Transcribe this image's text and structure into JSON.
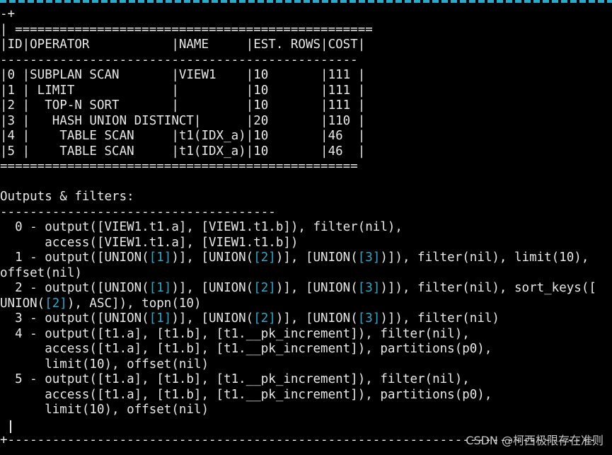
{
  "terminal": {
    "lines": [
      [
        {
          "t": "-+"
        }
      ],
      [
        {
          "t": "| ================================================"
        }
      ],
      [
        {
          "t": "|ID|OPERATOR           |NAME     |EST. ROWS|COST|"
        }
      ],
      [
        {
          "t": "------------------------------------------------"
        }
      ],
      [
        {
          "t": "|0 |SUBPLAN SCAN       |VIEW1    |10       |111 |"
        }
      ],
      [
        {
          "t": "|1 | LIMIT             |         |10       |111 |"
        }
      ],
      [
        {
          "t": "|2 |  TOP-N SORT       |         |10       |111 |"
        }
      ],
      [
        {
          "t": "|3 |   HASH UNION DISTINCT|      |20       |110 |"
        }
      ],
      [
        {
          "t": "|4 |    TABLE SCAN     |t1(IDX_a)|10       |46  |"
        }
      ],
      [
        {
          "t": "|5 |    TABLE SCAN     |t1(IDX_a)|10       |46  |"
        }
      ],
      [
        {
          "t": "================================================"
        }
      ],
      [
        {
          "t": ""
        }
      ],
      [
        {
          "t": "Outputs & filters:"
        }
      ],
      [
        {
          "t": "-------------------------------------"
        }
      ],
      [
        {
          "t": "  0 - output([VIEW1.t1.a], [VIEW1.t1.b]), filter(nil),"
        }
      ],
      [
        {
          "t": "      access([VIEW1.t1.a], [VIEW1.t1.b])"
        }
      ],
      [
        {
          "t": "  1 - output([UNION("
        },
        {
          "t": "[1]",
          "c": "ref"
        },
        {
          "t": ")], [UNION("
        },
        {
          "t": "[2]",
          "c": "ref"
        },
        {
          "t": ")], [UNION("
        },
        {
          "t": "[3]",
          "c": "ref"
        },
        {
          "t": ")]), filter(nil), limit(10),"
        }
      ],
      [
        {
          "t": "offset(nil)"
        }
      ],
      [
        {
          "t": "  2 - output([UNION("
        },
        {
          "t": "[1]",
          "c": "ref"
        },
        {
          "t": ")], [UNION("
        },
        {
          "t": "[2]",
          "c": "ref"
        },
        {
          "t": ")], [UNION("
        },
        {
          "t": "[3]",
          "c": "ref"
        },
        {
          "t": ")]), filter(nil), sort_keys(["
        }
      ],
      [
        {
          "t": "UNION("
        },
        {
          "t": "[2]",
          "c": "ref"
        },
        {
          "t": "), ASC]), topn(10)"
        }
      ],
      [
        {
          "t": "  3 - output([UNION("
        },
        {
          "t": "[1]",
          "c": "ref"
        },
        {
          "t": ")], [UNION("
        },
        {
          "t": "[2]",
          "c": "ref"
        },
        {
          "t": ")], [UNION("
        },
        {
          "t": "[3]",
          "c": "ref"
        },
        {
          "t": ")]), filter(nil)"
        }
      ],
      [
        {
          "t": "  4 - output([t1.a], [t1.b], [t1.__pk_increment]), filter(nil),"
        }
      ],
      [
        {
          "t": "      access([t1.a], [t1.b], [t1.__pk_increment]), partitions(p0),"
        }
      ],
      [
        {
          "t": "      limit(10), offset(nil)"
        }
      ],
      [
        {
          "t": "  5 - output([t1.a], [t1.b], [t1.__pk_increment]), filter(nil),"
        }
      ],
      [
        {
          "t": "      access([t1.a], [t1.b], [t1.__pk_increment]), partitions(p0),"
        }
      ],
      [
        {
          "t": "      limit(10), offset(nil)"
        }
      ],
      [
        {
          "t": ""
        }
      ]
    ],
    "bottom_border": "+-------------------------------------------------------------------------------",
    "watermark": "CSDN @柯西极限存在准则"
  },
  "colors": {
    "background": "#000000",
    "text": "#e8e8e8",
    "reference": "#2ea7c8"
  }
}
